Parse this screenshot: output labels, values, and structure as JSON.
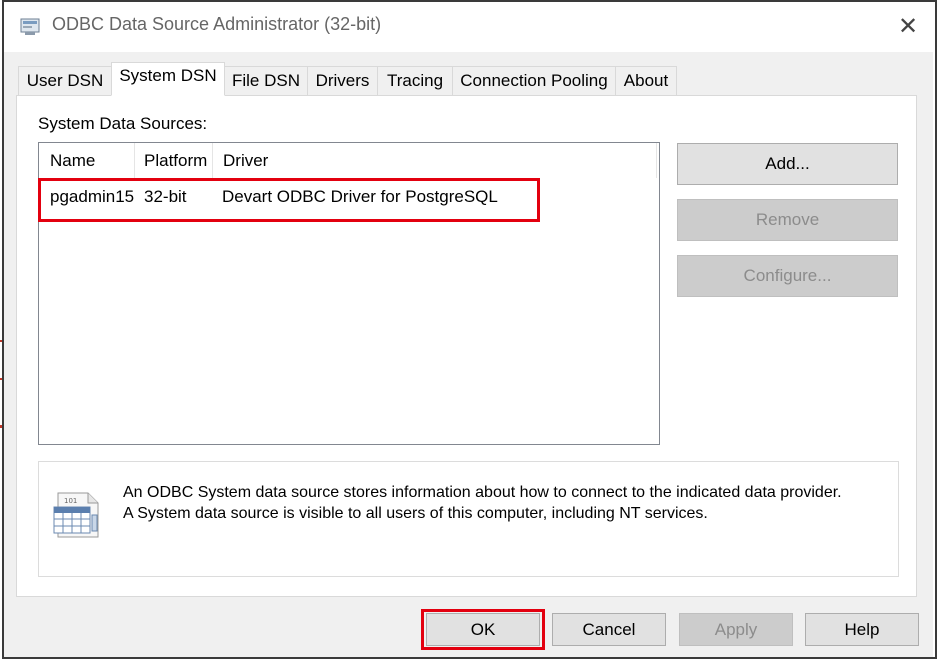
{
  "window": {
    "title": "ODBC Data Source Administrator (32-bit)",
    "close_glyph": "✕",
    "icon": "odbc-admin-icon"
  },
  "tabs": [
    {
      "label": "User DSN",
      "active": false
    },
    {
      "label": "System DSN",
      "active": true
    },
    {
      "label": "File DSN",
      "active": false
    },
    {
      "label": "Drivers",
      "active": false
    },
    {
      "label": "Tracing",
      "active": false
    },
    {
      "label": "Connection Pooling",
      "active": false
    },
    {
      "label": "About",
      "active": false
    }
  ],
  "panel": {
    "label": "System Data Sources:",
    "columns": [
      "Name",
      "Platform",
      "Driver"
    ],
    "rows": [
      {
        "name": "pgadmin15",
        "platform": "32-bit",
        "driver": "Devart ODBC Driver for PostgreSQL"
      }
    ],
    "buttons": {
      "add": "Add...",
      "remove": "Remove",
      "configure": "Configure..."
    },
    "info": {
      "line1": "An ODBC System data source stores information about how to connect to the indicated data provider.",
      "line2": "A System data source is visible to all users of this computer, including NT services.",
      "icon": "data-source-icon"
    }
  },
  "footer": {
    "ok": "OK",
    "cancel": "Cancel",
    "apply": "Apply",
    "help": "Help"
  },
  "colors": {
    "highlight": "#e3000f",
    "dialog_bg": "#f0f0f0",
    "disabled_text": "#8c8c8c"
  }
}
